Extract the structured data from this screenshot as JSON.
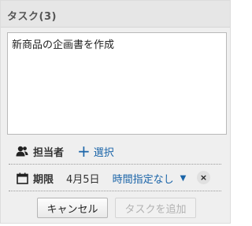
{
  "header": {
    "title": "タスク(3)"
  },
  "task_input": {
    "value": "新商品の企画書を作成"
  },
  "assignee": {
    "label": "担当者",
    "icon": "person-icon",
    "select_label": "選択"
  },
  "deadline": {
    "label": "期限",
    "icon": "calendar-icon",
    "date": "4月5日",
    "time_option": "時間指定なし",
    "clear_glyph": "×"
  },
  "buttons": {
    "cancel": "キャンセル",
    "add": "タスクを追加"
  },
  "colors": {
    "link": "#1a64a8",
    "panel_bg": "#efefef",
    "header_bg": "#e6e6e6"
  }
}
